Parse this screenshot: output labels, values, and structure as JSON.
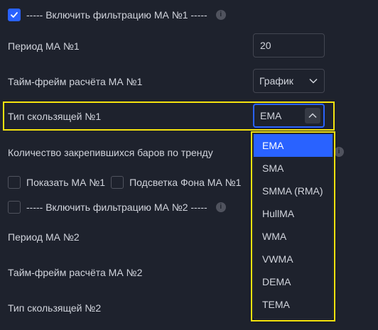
{
  "settings": {
    "ma1_filter": {
      "label": "----- Включить фильтрацию МА №1 -----",
      "checked": true
    },
    "ma1_period": {
      "label": "Период МА №1",
      "value": "20"
    },
    "ma1_timeframe": {
      "label": "Тайм-фрейм расчёта МА №1",
      "value": "График"
    },
    "ma1_type": {
      "label": "Тип скользящей №1",
      "value": "EMA"
    },
    "trend_bars": {
      "label": "Количество закрепившихся баров по тренду"
    },
    "show_ma1": {
      "label": "Показать МА №1",
      "checked": false
    },
    "bg_ma1": {
      "label": "Подсветка Фона МА №1",
      "checked": false
    },
    "ma2_filter": {
      "label": "----- Включить фильтрацию МА №2 -----",
      "checked": false
    },
    "ma2_period": {
      "label": "Период МА №2"
    },
    "ma2_timeframe": {
      "label": "Тайм-фрейм расчёта МА №2"
    },
    "ma2_type": {
      "label": "Тип скользящей №2"
    }
  },
  "dropdown": {
    "options": [
      "EMA",
      "SMA",
      "SMMA (RMA)",
      "HullMA",
      "WMA",
      "VWMA",
      "DEMA",
      "TEMA"
    ],
    "selected": "EMA"
  },
  "colors": {
    "background": "#1e222d",
    "accent": "#2962ff",
    "highlight": "#f5e30e",
    "text": "#d1d4dc"
  },
  "icons": {
    "info": "info-icon",
    "check": "check-icon",
    "chevron_down": "chevron-down-icon",
    "chevron_up": "chevron-up-icon"
  }
}
